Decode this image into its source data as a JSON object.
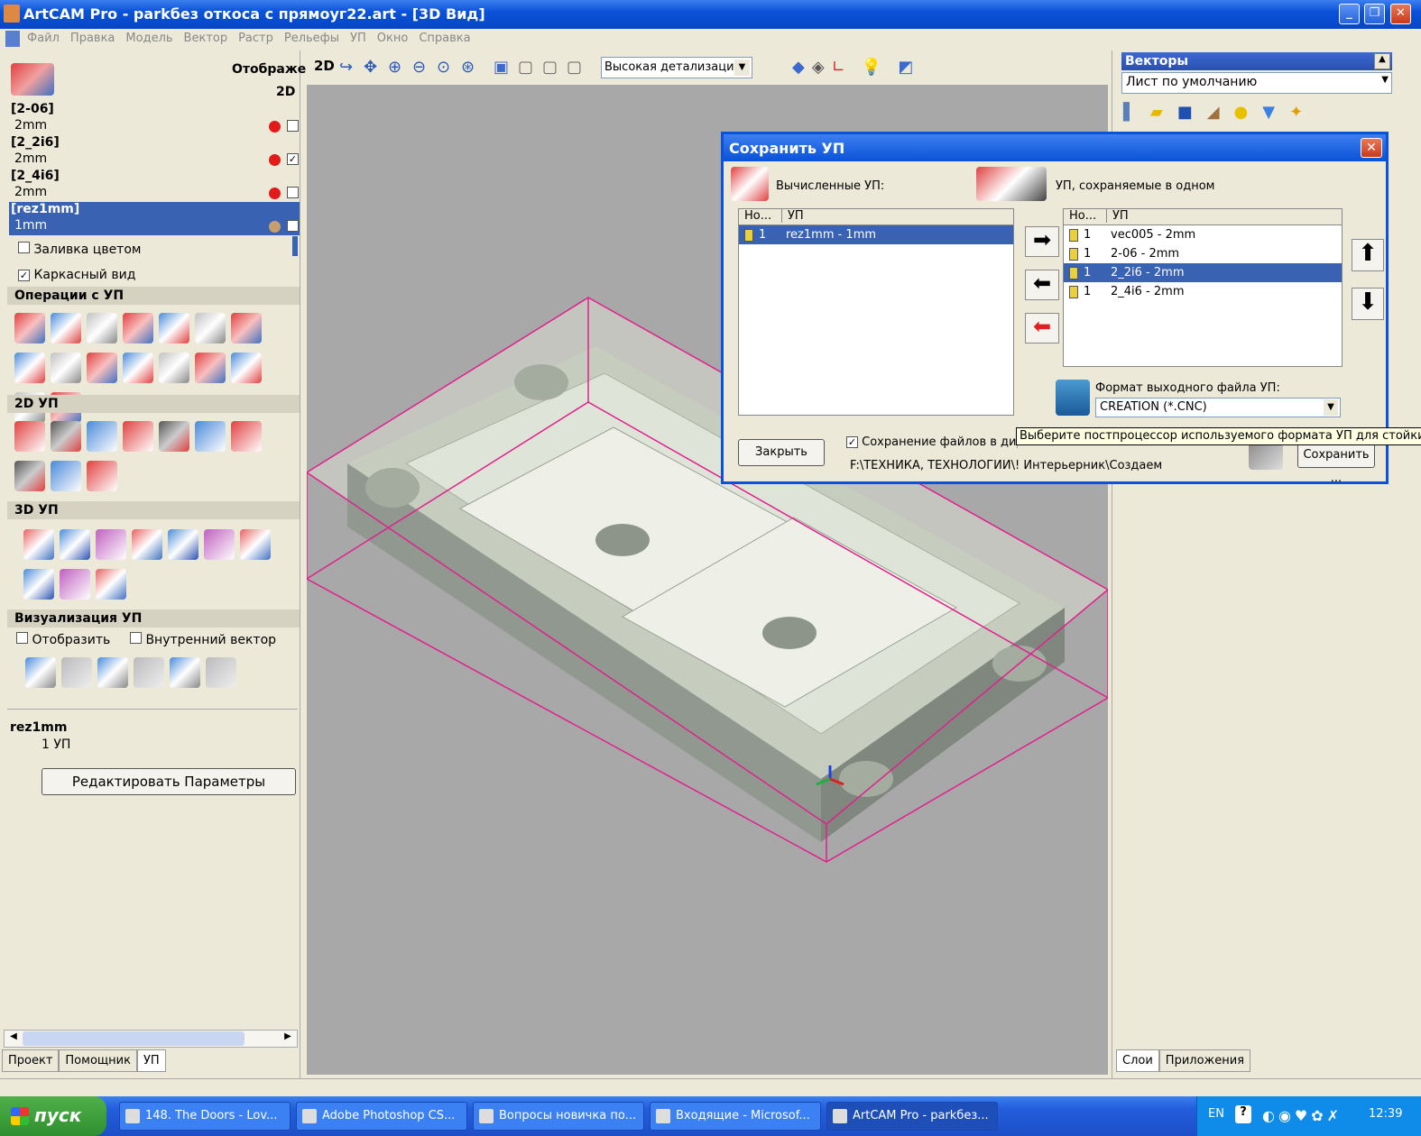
{
  "window": {
    "title": "ArtCAM Pro - parkбез откоса с прямоуг22.art - [3D Вид]"
  },
  "menu": [
    "Файл",
    "Правка",
    "Модель",
    "Вектор",
    "Растр",
    "Рельефы",
    "УП",
    "Окно",
    "Справка"
  ],
  "left": {
    "display_label": "Отображе",
    "display_2d": "2D",
    "layers": [
      {
        "name": "[2-06]",
        "tool": "2mm",
        "color": "#e21a1a",
        "checked": false
      },
      {
        "name": "[2_2i6]",
        "tool": "2mm",
        "color": "#e21a1a",
        "checked": true
      },
      {
        "name": "[2_4i6]",
        "tool": "2mm",
        "color": "#e21a1a",
        "checked": false
      },
      {
        "name": "[rez1mm]",
        "tool": "1mm",
        "color": "#c8a070",
        "checked": false
      }
    ],
    "fill_color": "Заливка цветом",
    "wireframe": "Каркасный вид",
    "sections": {
      "ops": "Операции с УП",
      "p2d": "2D УП",
      "p3d": "3D УП",
      "vis": "Визуализация УП"
    },
    "vis_show": "Отобразить",
    "vis_inner": "Внутренний вектор",
    "selected_name": "rez1mm",
    "selected_count": "1 УП",
    "edit_button": "Редактировать Параметры",
    "tabs": [
      "Проект",
      "Помощник",
      "УП"
    ]
  },
  "toolbar": {
    "mode": "2D",
    "detail": "Высокая детализация"
  },
  "right": {
    "title": "Векторы",
    "sheet": "Лист по умолчанию",
    "tabs": [
      "Слои",
      "Приложения"
    ]
  },
  "dialog": {
    "title": "Сохранить УП",
    "computed_label": "Вычисленные УП:",
    "saved_label": "УП, сохраняемые в одном",
    "col_no": "Но...",
    "col_up": "УП",
    "computed": [
      {
        "no": "1",
        "name": "rez1mm - 1mm"
      }
    ],
    "saved": [
      {
        "no": "1",
        "name": "vec005 - 2mm"
      },
      {
        "no": "1",
        "name": "2-06 - 2mm"
      },
      {
        "no": "1",
        "name": "2_2i6 - 2mm"
      },
      {
        "no": "1",
        "name": "2_4i6 - 2mm"
      }
    ],
    "format_label": "Формат выходного файла УП:",
    "format_value": "CREATION (*.CNC)",
    "close": "Закрыть",
    "save_dir": "Сохранение файлов в дире",
    "path": "F:\\ТЕХНИКА, ТЕХНОЛОГИИ\\! Интерьерник\\Создаем",
    "save": "Сохранить ...",
    "tooltip": "Выберите постпроцессор используемого формата УП для стойки ЧПУ"
  },
  "taskbar": {
    "start": "пуск",
    "tasks": [
      "148. The Doors - Lov...",
      "Adobe Photoshop CS...",
      "Вопросы новичка по...",
      "Входящие - Microsof...",
      "ArtCAM Pro - parkбез..."
    ],
    "lang": "EN",
    "time": "12:39"
  }
}
